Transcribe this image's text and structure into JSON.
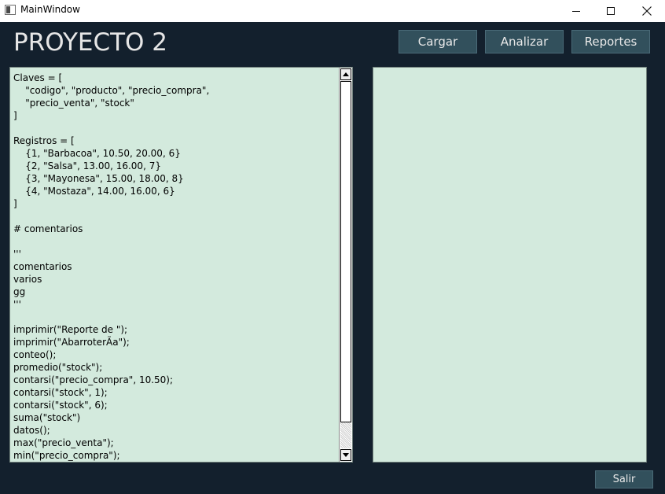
{
  "window": {
    "title": "MainWindow",
    "icons": {
      "app": "window-app-icon",
      "minimize": "minimize-icon",
      "maximize": "maximize-icon",
      "close": "close-icon"
    }
  },
  "header": {
    "title": "PROYECTO 2",
    "buttons": {
      "cargar": "Cargar",
      "analizar": "Analizar",
      "reportes": "Reportes"
    }
  },
  "editor": {
    "text": "Claves = [\n    \"codigo\", \"producto\", \"precio_compra\",\n    \"precio_venta\", \"stock\"\n]\n\nRegistros = [\n    {1, \"Barbacoa\", 10.50, 20.00, 6}\n    {2, \"Salsa\", 13.00, 16.00, 7}\n    {3, \"Mayonesa\", 15.00, 18.00, 8}\n    {4, \"Mostaza\", 14.00, 16.00, 6}\n]\n\n# comentarios\n\n'''\ncomentarios\nvarios\ngg\n'''\n\nimprimir(\"Reporte de \");\nimprimir(\"AbarroterÃa\");\nconteo();\npromedio(\"stock\");\ncontarsi(\"precio_compra\", 10.50);\ncontarsi(\"stock\", 1);\ncontarsi(\"stock\", 6);\nsuma(\"stock\")\ndatos();\nmax(\"precio_venta\");\nmin(\"precio_compra\");"
  },
  "output": {
    "text": ""
  },
  "footer": {
    "salir": "Salir"
  },
  "colors": {
    "background": "#13202d",
    "text_area": "#d3eadd",
    "button": "#32505c",
    "button_text": "#e8e8e8",
    "title_text": "#e6e6e6"
  }
}
